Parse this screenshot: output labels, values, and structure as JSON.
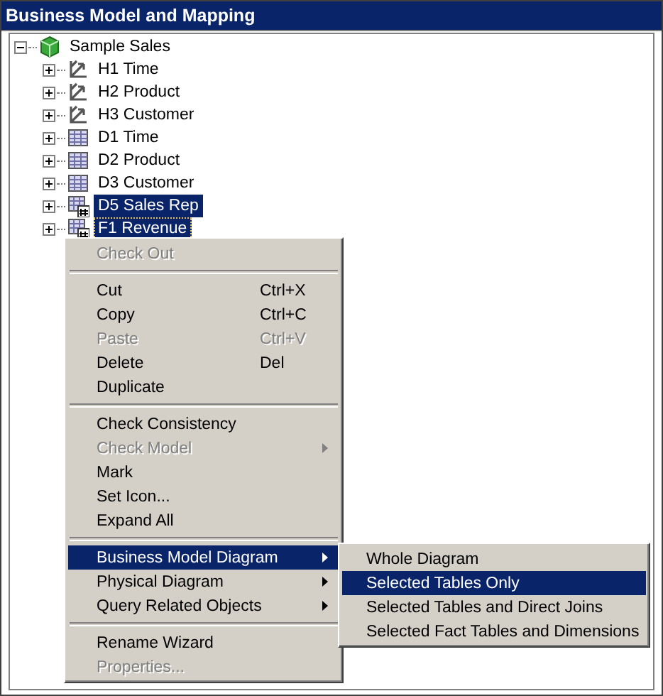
{
  "panel": {
    "title": "Business Model and Mapping"
  },
  "tree": {
    "label": "Sample Sales",
    "expanded": true,
    "children": [
      {
        "label": "H1 Time",
        "kind": "hierarchy",
        "selected": false,
        "focused": false
      },
      {
        "label": "H2 Product",
        "kind": "hierarchy",
        "selected": false,
        "focused": false
      },
      {
        "label": "H3 Customer",
        "kind": "hierarchy",
        "selected": false,
        "focused": false
      },
      {
        "label": "D1 Time",
        "kind": "table",
        "selected": false,
        "focused": false
      },
      {
        "label": "D2 Product",
        "kind": "table",
        "selected": false,
        "focused": false
      },
      {
        "label": "D3 Customer",
        "kind": "table",
        "selected": false,
        "focused": false
      },
      {
        "label": "D5 Sales Rep",
        "kind": "keyed",
        "selected": true,
        "focused": false
      },
      {
        "label": "F1 Revenue",
        "kind": "keyed",
        "selected": true,
        "focused": true
      }
    ]
  },
  "context_menu": [
    {
      "kind": "item",
      "label": "Check Out",
      "disabled": true,
      "selected": false
    },
    {
      "kind": "separator"
    },
    {
      "kind": "item",
      "label": "Cut",
      "shortcut": "Ctrl+X",
      "disabled": false,
      "selected": false
    },
    {
      "kind": "item",
      "label": "Copy",
      "shortcut": "Ctrl+C",
      "disabled": false,
      "selected": false
    },
    {
      "kind": "item",
      "label": "Paste",
      "shortcut": "Ctrl+V",
      "disabled": true,
      "selected": false
    },
    {
      "kind": "item",
      "label": "Delete",
      "shortcut": "Del",
      "disabled": false,
      "selected": false
    },
    {
      "kind": "item",
      "label": "Duplicate",
      "disabled": false,
      "selected": false
    },
    {
      "kind": "separator"
    },
    {
      "kind": "item",
      "label": "Check Consistency",
      "disabled": false,
      "selected": false
    },
    {
      "kind": "item",
      "label": "Check Model",
      "disabled": true,
      "selected": false,
      "submenu": true
    },
    {
      "kind": "item",
      "label": "Mark",
      "disabled": false,
      "selected": false
    },
    {
      "kind": "item",
      "label": "Set Icon...",
      "disabled": false,
      "selected": false
    },
    {
      "kind": "item",
      "label": "Expand All",
      "disabled": false,
      "selected": false
    },
    {
      "kind": "separator"
    },
    {
      "kind": "item",
      "label": "Business Model Diagram",
      "disabled": false,
      "selected": true,
      "submenu": true
    },
    {
      "kind": "item",
      "label": "Physical Diagram",
      "disabled": false,
      "selected": false,
      "submenu": true
    },
    {
      "kind": "item",
      "label": "Query Related Objects",
      "disabled": false,
      "selected": false,
      "submenu": true
    },
    {
      "kind": "separator"
    },
    {
      "kind": "item",
      "label": "Rename Wizard",
      "disabled": false,
      "selected": false
    },
    {
      "kind": "item",
      "label": "Properties...",
      "disabled": true,
      "selected": false
    }
  ],
  "submenu": [
    {
      "label": "Whole Diagram",
      "selected": false
    },
    {
      "label": "Selected Tables Only",
      "selected": true
    },
    {
      "label": "Selected Tables and Direct Joins",
      "selected": false
    },
    {
      "label": "Selected Fact Tables and Dimensions",
      "selected": false
    }
  ]
}
